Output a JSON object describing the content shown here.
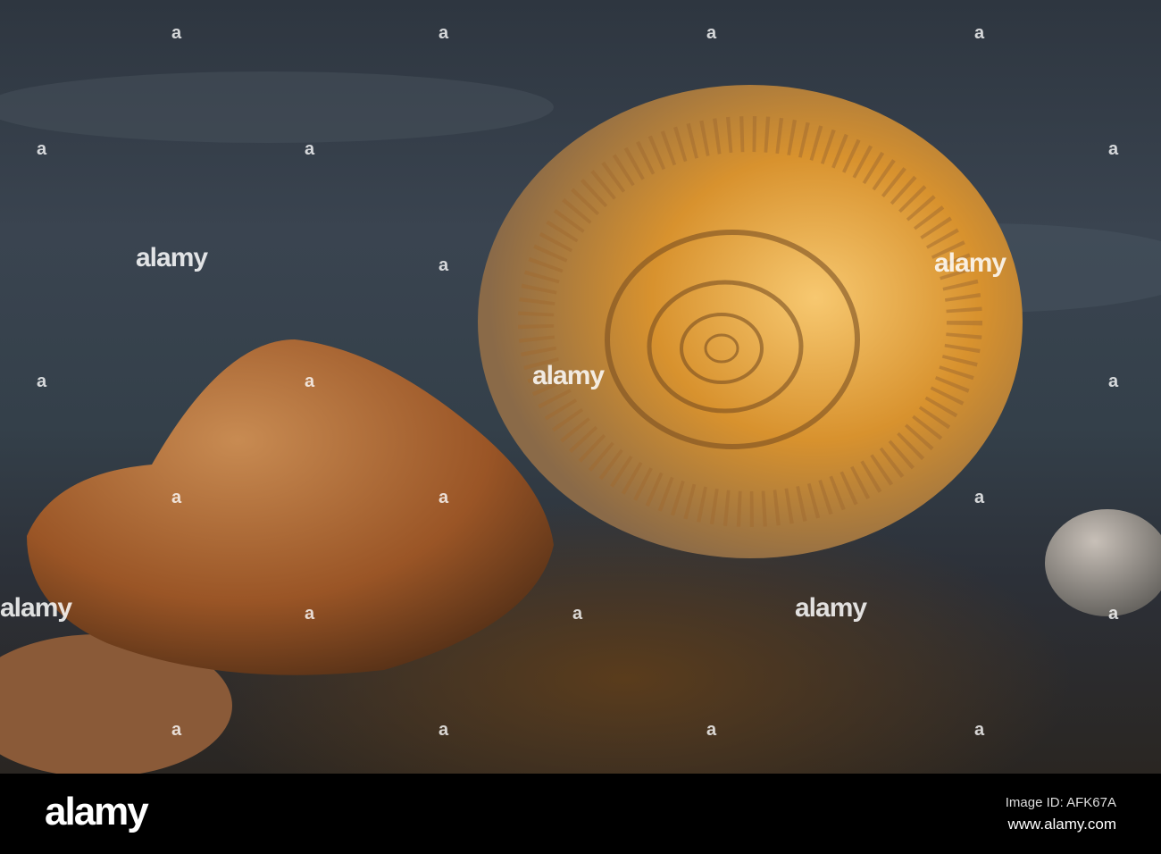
{
  "watermark": {
    "text": "alamy",
    "mark": "a"
  },
  "footer": {
    "logo": "alamy",
    "image_id": "Image ID: AFK67A",
    "website": "www.alamy.com"
  },
  "colors": {
    "water": "#34404a",
    "ammonite": "#d99a3c",
    "rock": "#a05a2a",
    "footer": "#000000"
  }
}
